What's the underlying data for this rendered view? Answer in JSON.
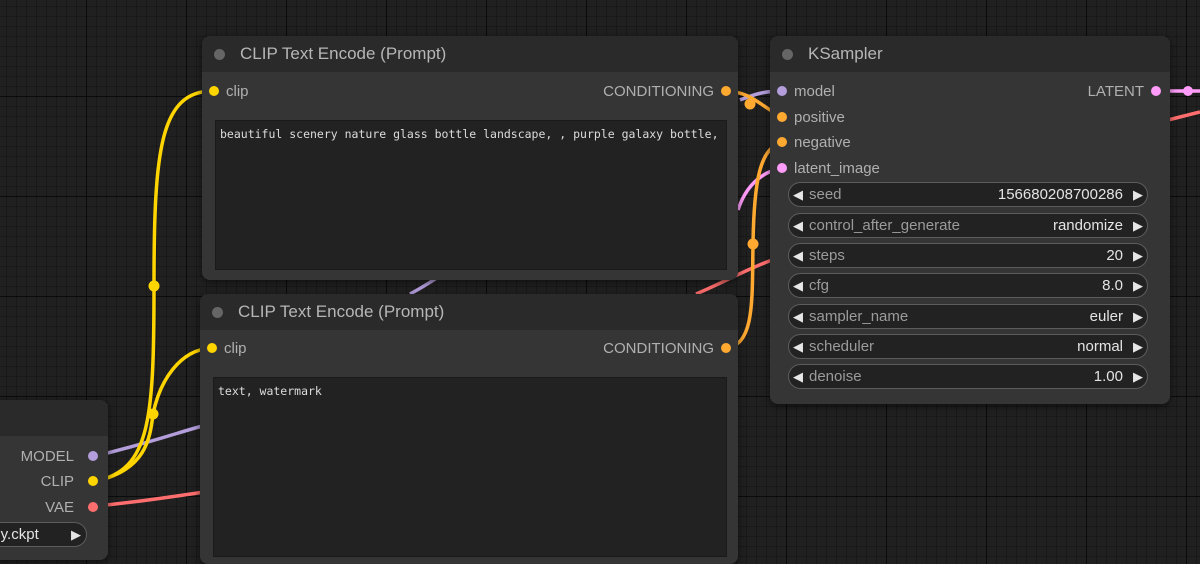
{
  "colors": {
    "clip": "#ffd500",
    "conditioning": "#ffa931",
    "model": "#b39ddb",
    "latent": "#ff9cf9",
    "vae": "#ff6e6e"
  },
  "positive_node": {
    "title": "CLIP Text Encode (Prompt)",
    "input_label": "clip",
    "output_label": "CONDITIONING",
    "text": "beautiful scenery nature glass bottle landscape, , purple galaxy bottle,"
  },
  "negative_node": {
    "title": "CLIP Text Encode (Prompt)",
    "input_label": "clip",
    "output_label": "CONDITIONING",
    "text": "text, watermark"
  },
  "ksampler": {
    "title": "KSampler",
    "inputs": [
      "model",
      "positive",
      "negative",
      "latent_image"
    ],
    "output_label": "LATENT",
    "widgets": [
      {
        "label": "seed",
        "value": "156680208700286"
      },
      {
        "label": "control_after_generate",
        "value": "randomize"
      },
      {
        "label": "steps",
        "value": "20"
      },
      {
        "label": "cfg",
        "value": "8.0"
      },
      {
        "label": "sampler_name",
        "value": "euler"
      },
      {
        "label": "scheduler",
        "value": "normal"
      },
      {
        "label": "denoise",
        "value": "1.00"
      }
    ]
  },
  "checkpoint_loader": {
    "outputs": [
      "MODEL",
      "CLIP",
      "VAE"
    ],
    "ckpt_name": "uly.ckpt"
  }
}
